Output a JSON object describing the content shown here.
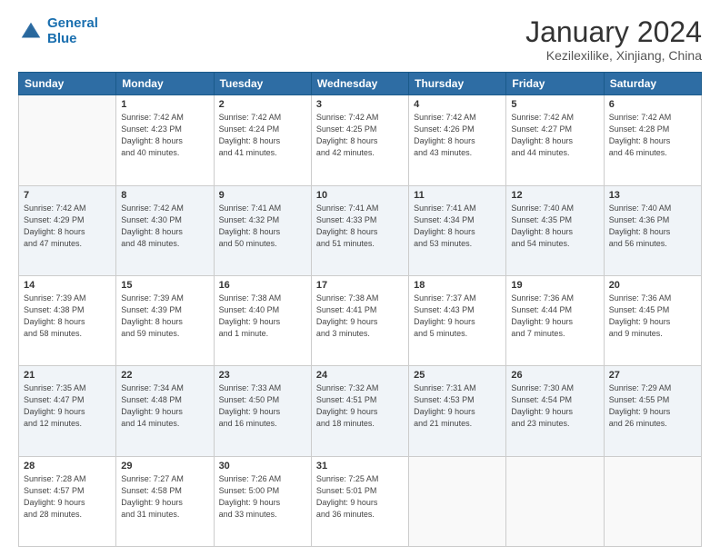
{
  "header": {
    "logo_line1": "General",
    "logo_line2": "Blue",
    "month": "January 2024",
    "location": "Kezilexilike, Xinjiang, China"
  },
  "weekdays": [
    "Sunday",
    "Monday",
    "Tuesday",
    "Wednesday",
    "Thursday",
    "Friday",
    "Saturday"
  ],
  "weeks": [
    [
      {
        "day": "",
        "detail": ""
      },
      {
        "day": "1",
        "detail": "Sunrise: 7:42 AM\nSunset: 4:23 PM\nDaylight: 8 hours\nand 40 minutes."
      },
      {
        "day": "2",
        "detail": "Sunrise: 7:42 AM\nSunset: 4:24 PM\nDaylight: 8 hours\nand 41 minutes."
      },
      {
        "day": "3",
        "detail": "Sunrise: 7:42 AM\nSunset: 4:25 PM\nDaylight: 8 hours\nand 42 minutes."
      },
      {
        "day": "4",
        "detail": "Sunrise: 7:42 AM\nSunset: 4:26 PM\nDaylight: 8 hours\nand 43 minutes."
      },
      {
        "day": "5",
        "detail": "Sunrise: 7:42 AM\nSunset: 4:27 PM\nDaylight: 8 hours\nand 44 minutes."
      },
      {
        "day": "6",
        "detail": "Sunrise: 7:42 AM\nSunset: 4:28 PM\nDaylight: 8 hours\nand 46 minutes."
      }
    ],
    [
      {
        "day": "7",
        "detail": "Sunrise: 7:42 AM\nSunset: 4:29 PM\nDaylight: 8 hours\nand 47 minutes."
      },
      {
        "day": "8",
        "detail": "Sunrise: 7:42 AM\nSunset: 4:30 PM\nDaylight: 8 hours\nand 48 minutes."
      },
      {
        "day": "9",
        "detail": "Sunrise: 7:41 AM\nSunset: 4:32 PM\nDaylight: 8 hours\nand 50 minutes."
      },
      {
        "day": "10",
        "detail": "Sunrise: 7:41 AM\nSunset: 4:33 PM\nDaylight: 8 hours\nand 51 minutes."
      },
      {
        "day": "11",
        "detail": "Sunrise: 7:41 AM\nSunset: 4:34 PM\nDaylight: 8 hours\nand 53 minutes."
      },
      {
        "day": "12",
        "detail": "Sunrise: 7:40 AM\nSunset: 4:35 PM\nDaylight: 8 hours\nand 54 minutes."
      },
      {
        "day": "13",
        "detail": "Sunrise: 7:40 AM\nSunset: 4:36 PM\nDaylight: 8 hours\nand 56 minutes."
      }
    ],
    [
      {
        "day": "14",
        "detail": "Sunrise: 7:39 AM\nSunset: 4:38 PM\nDaylight: 8 hours\nand 58 minutes."
      },
      {
        "day": "15",
        "detail": "Sunrise: 7:39 AM\nSunset: 4:39 PM\nDaylight: 8 hours\nand 59 minutes."
      },
      {
        "day": "16",
        "detail": "Sunrise: 7:38 AM\nSunset: 4:40 PM\nDaylight: 9 hours\nand 1 minute."
      },
      {
        "day": "17",
        "detail": "Sunrise: 7:38 AM\nSunset: 4:41 PM\nDaylight: 9 hours\nand 3 minutes."
      },
      {
        "day": "18",
        "detail": "Sunrise: 7:37 AM\nSunset: 4:43 PM\nDaylight: 9 hours\nand 5 minutes."
      },
      {
        "day": "19",
        "detail": "Sunrise: 7:36 AM\nSunset: 4:44 PM\nDaylight: 9 hours\nand 7 minutes."
      },
      {
        "day": "20",
        "detail": "Sunrise: 7:36 AM\nSunset: 4:45 PM\nDaylight: 9 hours\nand 9 minutes."
      }
    ],
    [
      {
        "day": "21",
        "detail": "Sunrise: 7:35 AM\nSunset: 4:47 PM\nDaylight: 9 hours\nand 12 minutes."
      },
      {
        "day": "22",
        "detail": "Sunrise: 7:34 AM\nSunset: 4:48 PM\nDaylight: 9 hours\nand 14 minutes."
      },
      {
        "day": "23",
        "detail": "Sunrise: 7:33 AM\nSunset: 4:50 PM\nDaylight: 9 hours\nand 16 minutes."
      },
      {
        "day": "24",
        "detail": "Sunrise: 7:32 AM\nSunset: 4:51 PM\nDaylight: 9 hours\nand 18 minutes."
      },
      {
        "day": "25",
        "detail": "Sunrise: 7:31 AM\nSunset: 4:53 PM\nDaylight: 9 hours\nand 21 minutes."
      },
      {
        "day": "26",
        "detail": "Sunrise: 7:30 AM\nSunset: 4:54 PM\nDaylight: 9 hours\nand 23 minutes."
      },
      {
        "day": "27",
        "detail": "Sunrise: 7:29 AM\nSunset: 4:55 PM\nDaylight: 9 hours\nand 26 minutes."
      }
    ],
    [
      {
        "day": "28",
        "detail": "Sunrise: 7:28 AM\nSunset: 4:57 PM\nDaylight: 9 hours\nand 28 minutes."
      },
      {
        "day": "29",
        "detail": "Sunrise: 7:27 AM\nSunset: 4:58 PM\nDaylight: 9 hours\nand 31 minutes."
      },
      {
        "day": "30",
        "detail": "Sunrise: 7:26 AM\nSunset: 5:00 PM\nDaylight: 9 hours\nand 33 minutes."
      },
      {
        "day": "31",
        "detail": "Sunrise: 7:25 AM\nSunset: 5:01 PM\nDaylight: 9 hours\nand 36 minutes."
      },
      {
        "day": "",
        "detail": ""
      },
      {
        "day": "",
        "detail": ""
      },
      {
        "day": "",
        "detail": ""
      }
    ]
  ]
}
